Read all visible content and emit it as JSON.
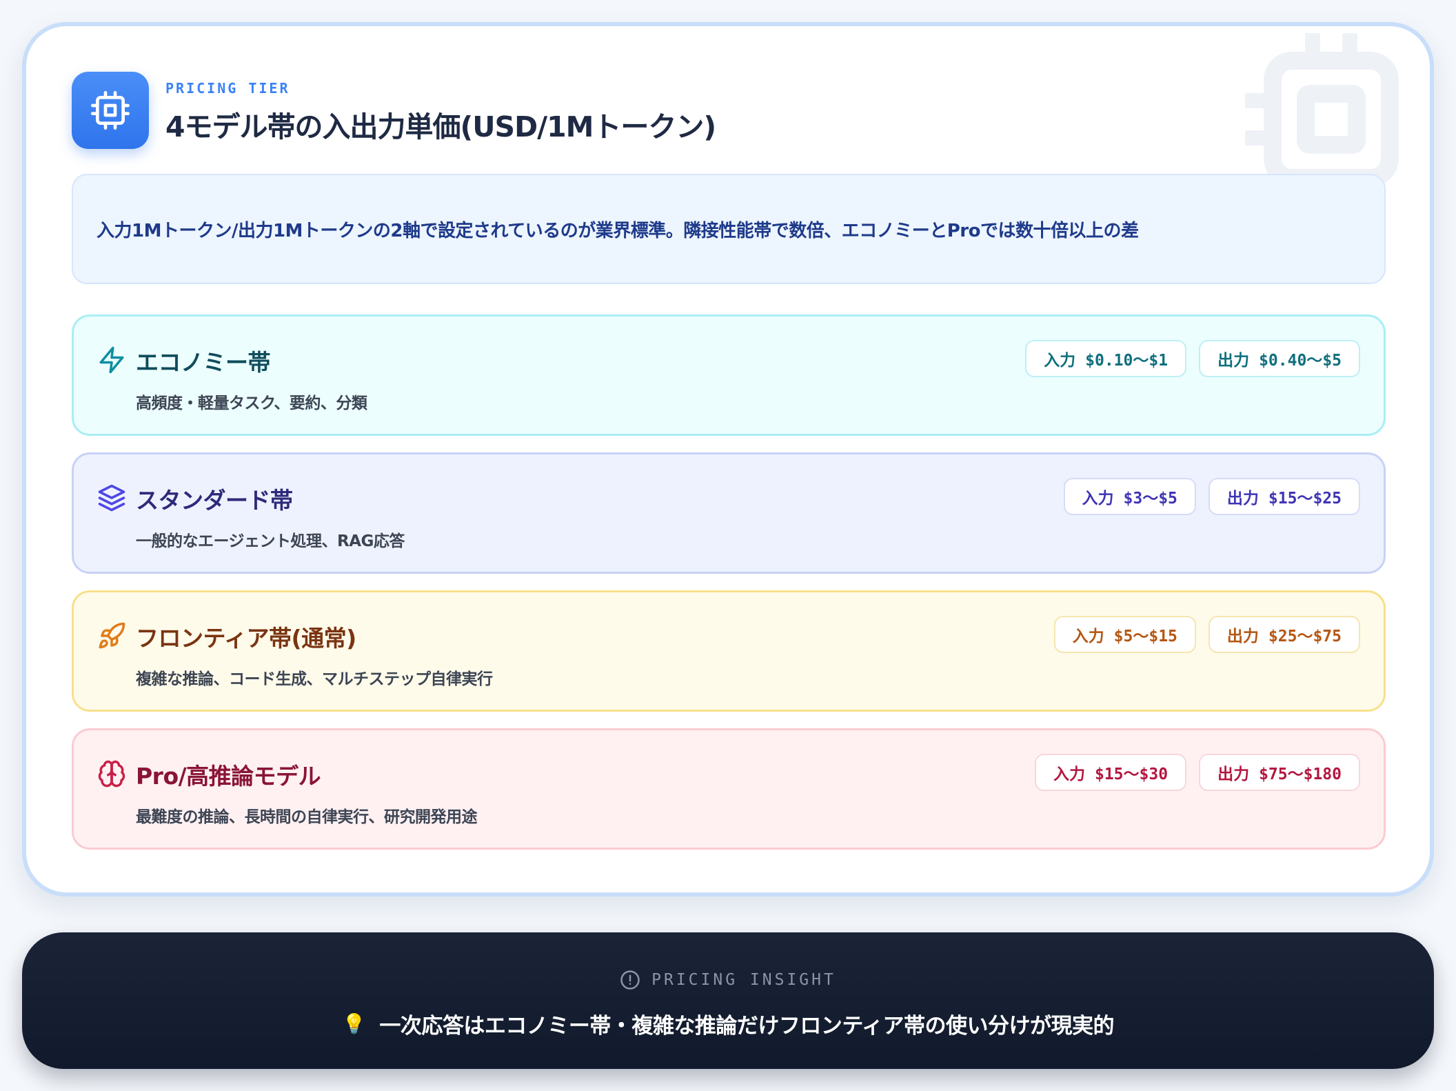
{
  "header": {
    "kicker": "PRICING TIER",
    "title": "4モデル帯の入出力単価(USD/1Mトークン)",
    "icon": "cpu-chip-icon"
  },
  "summary": "入力1Mトークン/出力1Mトークンの2軸で設定されているのが業界標準。隣接性能帯で数倍、エコノミーとProでは数十倍以上の差",
  "tiers": [
    {
      "icon": "lightning-icon",
      "name": "エコノミー帯",
      "description": "高頻度・軽量タスク、要約、分類",
      "input_label": "入力",
      "input_price": "$0.10〜$1",
      "output_label": "出力",
      "output_price": "$0.40〜$5",
      "color": "#0e7490"
    },
    {
      "icon": "layers-icon",
      "name": "スタンダード帯",
      "description": "一般的なエージェント処理、RAG応答",
      "input_label": "入力",
      "input_price": "$3〜$5",
      "output_label": "出力",
      "output_price": "$15〜$25",
      "color": "#4f46e5"
    },
    {
      "icon": "rocket-icon",
      "name": "フロンティア帯(通常)",
      "description": "複雑な推論、コード生成、マルチステップ自律実行",
      "input_label": "入力",
      "input_price": "$5〜$15",
      "output_label": "出力",
      "output_price": "$25〜$75",
      "color": "#d97706"
    },
    {
      "icon": "brain-icon",
      "name": "Pro/高推論モデル",
      "description": "最難度の推論、長時間の自律実行、研究開発用途",
      "input_label": "入力",
      "input_price": "$15〜$30",
      "output_label": "出力",
      "output_price": "$75〜$180",
      "color": "#be123c"
    }
  ],
  "insight": {
    "icon": "alert-circle-icon",
    "kicker": "PRICING INSIGHT",
    "emoji": "💡",
    "text": "一次応答はエコノミー帯・複雑な推論だけフロンティア帯の使い分けが現実的"
  }
}
